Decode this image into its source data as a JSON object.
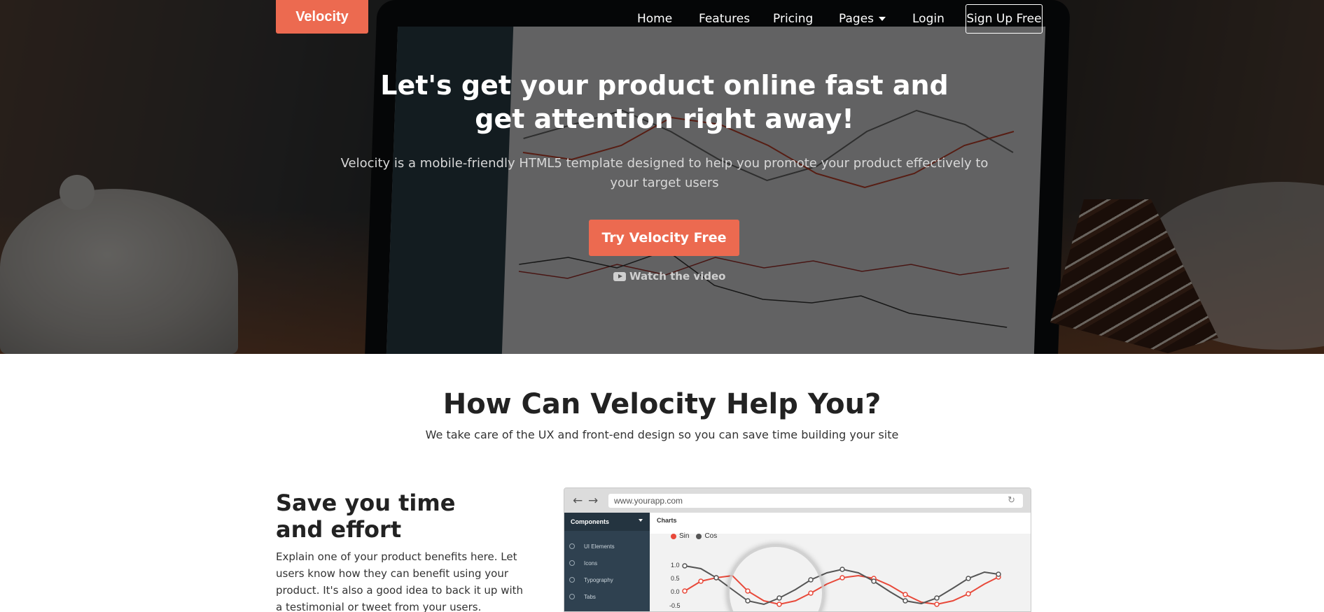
{
  "nav": {
    "brand": "Velocity",
    "items": [
      {
        "label": "Home"
      },
      {
        "label": "Features"
      },
      {
        "label": "Pricing"
      },
      {
        "label": "Pages"
      },
      {
        "label": "Login"
      }
    ],
    "signup": "Sign Up Free"
  },
  "hero": {
    "title": "Let's get your product online fast and get attention right away!",
    "subtitle": "Velocity is a mobile-friendly HTML5 template designed to help you promote your product effectively to your target users",
    "cta": "Try Velocity Free",
    "video_link": "Watch the video"
  },
  "section": {
    "title": "How Can Velocity Help You?",
    "subtitle": "We take care of the UX and front-end design so you can save time building your site"
  },
  "feature": {
    "title": "Save you time and effort",
    "text": "Explain one of your product benefits here. Let users know how they can benefit using your product. It's also a good idea to back it up with a testimonial or tweet from your users."
  },
  "browser_mock": {
    "url": "www.yourapp.com",
    "sidebar_header": "Components",
    "sidebar_items": [
      "UI Elements",
      "Icons",
      "Typography",
      "Tabs"
    ],
    "main_title": "Charts",
    "chart": {
      "legend": [
        {
          "name": "Sin",
          "color": "#e8493a"
        },
        {
          "name": "Cos",
          "color": "#555555"
        }
      ],
      "y_ticks": [
        "1.0",
        "0.5",
        "0.0",
        "-0.5"
      ]
    }
  },
  "colors": {
    "accent": "#ec6a50",
    "hero_text": "#ffffff"
  }
}
